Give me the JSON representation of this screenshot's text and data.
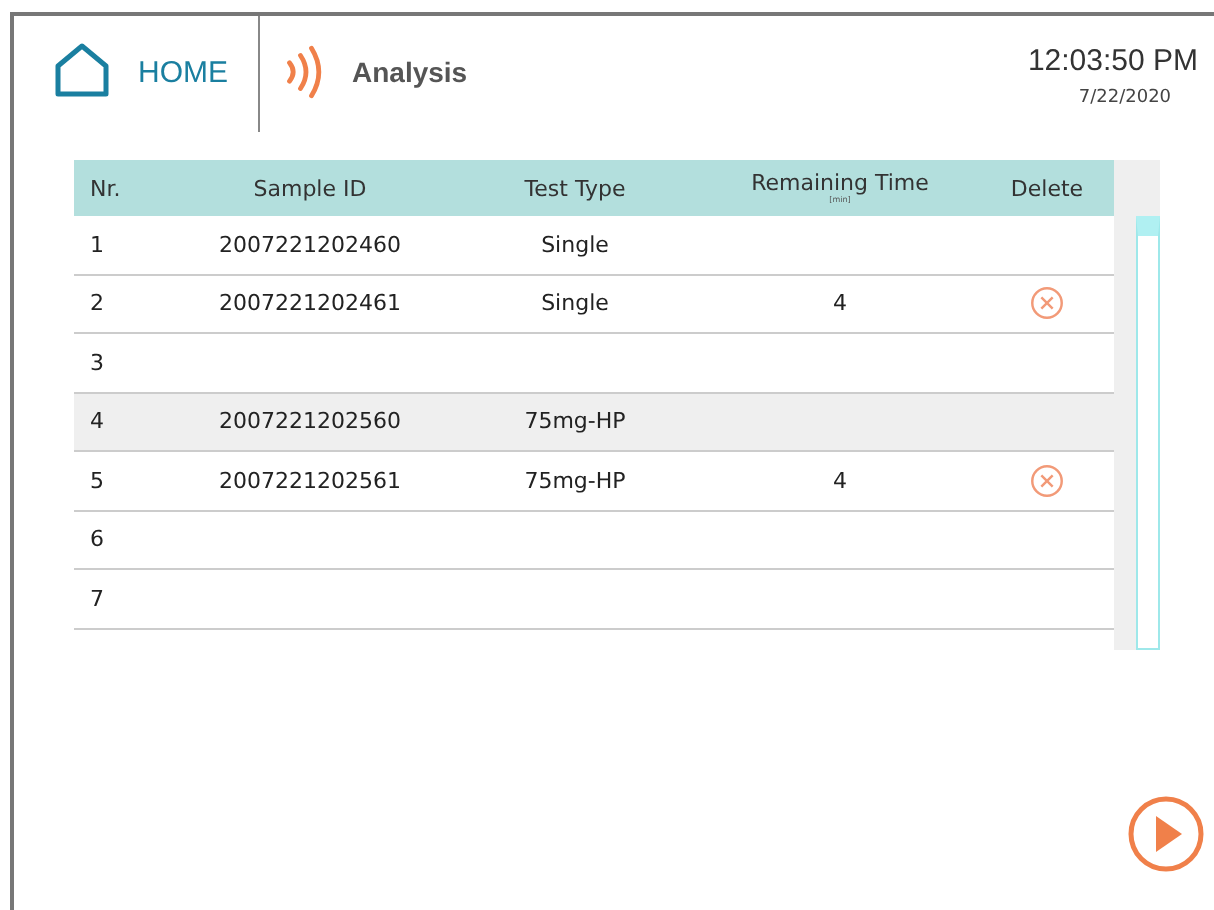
{
  "header": {
    "home_label": "HOME",
    "title": "Analysis",
    "time": "12:03:50 PM",
    "date": "7/22/2020"
  },
  "table": {
    "columns": [
      {
        "label": "Nr."
      },
      {
        "label": "Sample ID"
      },
      {
        "label": "Test Type"
      },
      {
        "label": "Remaining Time",
        "unit": "[min]"
      },
      {
        "label": "Delete"
      }
    ],
    "rows": [
      {
        "nr": "1",
        "sample_id": "2007221202460",
        "test_type": "Single",
        "remaining": "",
        "deletable": false,
        "selected": false
      },
      {
        "nr": "2",
        "sample_id": "2007221202461",
        "test_type": "Single",
        "remaining": "4",
        "deletable": true,
        "selected": false
      },
      {
        "nr": "3",
        "sample_id": "",
        "test_type": "",
        "remaining": "",
        "deletable": false,
        "selected": false
      },
      {
        "nr": "4",
        "sample_id": "2007221202560",
        "test_type": "75mg-HP",
        "remaining": "",
        "deletable": false,
        "selected": true
      },
      {
        "nr": "5",
        "sample_id": "2007221202561",
        "test_type": "75mg-HP",
        "remaining": "4",
        "deletable": true,
        "selected": false
      },
      {
        "nr": "6",
        "sample_id": "",
        "test_type": "",
        "remaining": "",
        "deletable": false,
        "selected": false
      },
      {
        "nr": "7",
        "sample_id": "",
        "test_type": "",
        "remaining": "",
        "deletable": false,
        "selected": false
      }
    ]
  }
}
